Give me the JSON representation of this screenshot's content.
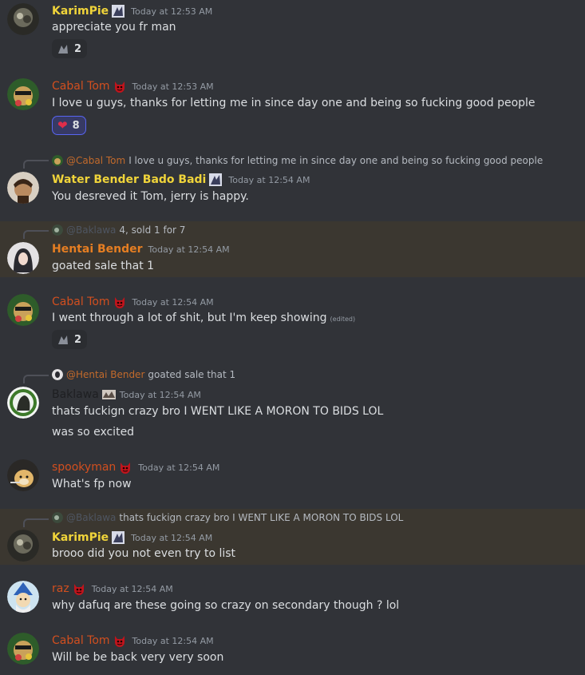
{
  "messages": [
    {
      "author": "KarimPie",
      "author_color": "#f0d43a",
      "badge": "karim-badge",
      "timestamp": "Today at 12:53 AM",
      "lines": [
        "appreciate you fr man"
      ],
      "reaction": {
        "icon": "custom-emoji",
        "count": "2"
      }
    },
    {
      "author": "Cabal Tom",
      "author_color": "#d14f1f",
      "badge": "devil-emoji",
      "timestamp": "Today at 12:53 AM",
      "lines": [
        "I love u guys, thanks for letting me in since day one and being so fucking good people"
      ],
      "reaction": {
        "icon": "heart-emoji",
        "count": "8"
      }
    },
    {
      "author": "Water Bender Bado Badi",
      "author_color": "#f0d43a",
      "badge": "karim-badge",
      "timestamp": "Today at 12:54 AM",
      "reply": {
        "name": "@Cabal Tom",
        "text": "I love u guys, thanks for letting me in since day one and being so fucking good people"
      },
      "lines": [
        "You desreved it Tom, jerry is happy."
      ]
    },
    {
      "author": "Hentai Bender",
      "author_color": "#e67e22",
      "timestamp": "Today at 12:54 AM",
      "reply": {
        "name": "@Baklawa",
        "text": "4, sold 1 for 7"
      },
      "lines": [
        "goated sale that 1"
      ]
    },
    {
      "author": "Cabal Tom",
      "author_color": "#d14f1f",
      "badge": "devil-emoji",
      "timestamp": "Today at 12:54 AM",
      "lines": [
        "I went through a lot of shit, but I'm keep showing"
      ],
      "edited": "(edited)",
      "reaction": {
        "icon": "custom-emoji",
        "count": "2"
      }
    },
    {
      "author": "Baklawa",
      "author_color": "#1e1f22",
      "badge": "baklawa-badge",
      "timestamp": "Today at 12:54 AM",
      "reply": {
        "name": "@Hentai Bender",
        "text": "goated sale that 1"
      },
      "lines": [
        "thats fuckign crazy bro I WENT LIKE A MORON TO BIDS LOL",
        "was so excited"
      ]
    },
    {
      "author": "spookyman",
      "author_color": "#d14f1f",
      "badge": "devil-emoji",
      "timestamp": "Today at 12:54 AM",
      "lines": [
        "What's fp now"
      ]
    },
    {
      "author": "KarimPie",
      "author_color": "#f0d43a",
      "badge": "karim-badge",
      "timestamp": "Today at 12:54 AM",
      "reply": {
        "name": "@Baklawa",
        "text": "thats fuckign crazy bro I WENT LIKE A MORON TO BIDS LOL"
      },
      "lines": [
        "brooo did you not even try to list"
      ]
    },
    {
      "author": "raz",
      "author_color": "#d14f1f",
      "badge": "devil-emoji",
      "timestamp": "Today at 12:54 AM",
      "lines": [
        "why dafuq are these going so crazy on secondary though ? lol"
      ]
    },
    {
      "author": "Cabal Tom",
      "author_color": "#d14f1f",
      "badge": "devil-emoji",
      "timestamp": "Today at 12:54 AM",
      "lines": [
        "Will be be back very very soon"
      ]
    }
  ],
  "colors": {
    "background": "#313338",
    "highlight": "#3b3730",
    "reply_name_orange": "#c26a2b",
    "reply_name_dim": "#4e5561",
    "mention_highlight": "#7d5a3a"
  }
}
